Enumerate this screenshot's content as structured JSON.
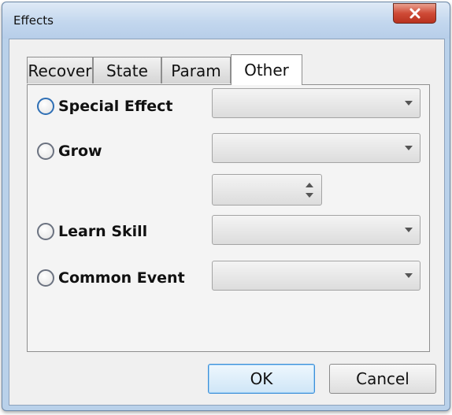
{
  "window": {
    "title": "Effects"
  },
  "tabs": [
    {
      "label": "Recover",
      "active": false
    },
    {
      "label": "State",
      "active": false
    },
    {
      "label": "Param",
      "active": false
    },
    {
      "label": "Other",
      "active": true
    }
  ],
  "options": {
    "special_effect": {
      "label": "Special Effect",
      "selected": false
    },
    "grow": {
      "label": "Grow",
      "selected": false
    },
    "learn_skill": {
      "label": "Learn Skill",
      "selected": false
    },
    "common_event": {
      "label": "Common Event",
      "selected": false
    }
  },
  "fields": {
    "special_effect_value": "",
    "grow_param_value": "",
    "grow_amount_value": "",
    "learn_skill_value": "",
    "common_event_value": ""
  },
  "buttons": {
    "ok": "OK",
    "cancel": "Cancel"
  },
  "icons": {
    "close": "close-icon",
    "dropdown": "chevron-down-icon",
    "spin_up": "chevron-up-icon",
    "spin_down": "chevron-down-icon"
  }
}
